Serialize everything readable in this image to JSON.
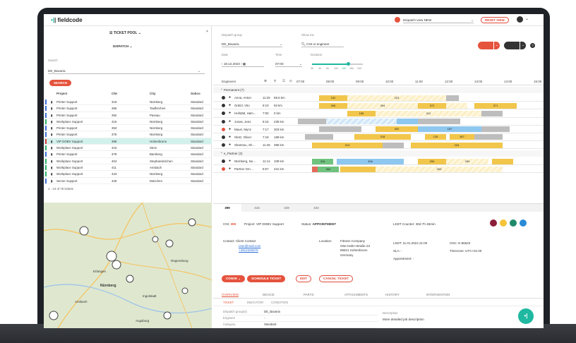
{
  "app": {
    "logo": "fieldcode",
    "dispatch_view": "Dispatch view NEW",
    "reset_view": "RESET VIEW"
  },
  "left": {
    "ticket_pool": "TICKET POOL",
    "dispatch": "DISPATCH",
    "search_label": "Search",
    "search_value": "DE_Bavaria",
    "search_button": "SEARCH",
    "columns": [
      "Project",
      "CNI",
      "City",
      "Subco"
    ],
    "rows": [
      {
        "project": "Printer Support",
        "cni": "319",
        "city": "Nürnberg",
        "subco": "Standard",
        "color": "#3b6fd6"
      },
      {
        "project": "Printer Support",
        "cni": "365",
        "city": "Taufkirchen",
        "subco": "Standard",
        "color": "#3b6fd6"
      },
      {
        "project": "Printer Support",
        "cni": "392",
        "city": "Passau",
        "subco": "Standard",
        "color": "#3b6fd6"
      },
      {
        "project": "Workplace Support",
        "cni": "415",
        "city": "Nürnberg",
        "subco": "Standard",
        "color": "#2fb36b"
      },
      {
        "project": "Printer Support",
        "cni": "353",
        "city": "Nürnberg",
        "subco": "Standard",
        "color": "#3b6fd6"
      },
      {
        "project": "Printer Support",
        "cni": "375",
        "city": "Nürnberg",
        "subco": "Standard",
        "color": "#3b6fd6"
      },
      {
        "project": "VIP DOBV Support",
        "cni": "399",
        "city": "Hohenbrunn",
        "subco": "Standard",
        "color": "#d63b3b"
      },
      {
        "project": "Workplace Support",
        "cni": "416",
        "city": "Stein",
        "subco": "Standard",
        "color": "#2fb36b"
      },
      {
        "project": "Printer Support",
        "cni": "378",
        "city": "Bamberg",
        "subco": "Standard",
        "color": "#3b6fd6"
      },
      {
        "project": "Workplace Support",
        "cni": "404",
        "city": "Stephanskirchen",
        "subco": "Standard",
        "color": "#2fb36b"
      },
      {
        "project": "Workplace Support",
        "cni": "411",
        "city": "Ansbach",
        "subco": "Standard",
        "color": "#2fb36b"
      },
      {
        "project": "Workplace Support",
        "cni": "423",
        "city": "Nürnberg",
        "subco": "Standard",
        "color": "#2fb36b"
      },
      {
        "project": "Server Support",
        "cni": "429",
        "city": "München",
        "subco": "Standard",
        "color": "#3b6fd6"
      }
    ],
    "count": "1 - 13 of 76 tickets"
  },
  "map": {
    "cities": [
      "Erlangen",
      "Nürnberg",
      "Ansbach",
      "Augsburg",
      "Regensburg",
      "Ingolstadt"
    ]
  },
  "gantt": {
    "dispatch_group_label": "Dispatch group",
    "dispatch_group": "DE_Bavaria",
    "show_me_label": "Show me",
    "show_me": "CNI or engineer",
    "date_label": "Date",
    "date": "19.12.2023",
    "time_label": "Time",
    "time": "07:00",
    "duration_label": "Duration",
    "durations": [
      "3h",
      "4h",
      "6h",
      "10h",
      "12h",
      "16h",
      "24h"
    ],
    "engineers_label": "Engineers",
    "hours": [
      "07:00",
      "08:00",
      "09:00",
      "10:00",
      "11:00",
      "12:00",
      "13:00",
      "14:00",
      "15:00"
    ],
    "group1": "Permanent (7)",
    "group2": "e_Partner (2)",
    "engineers": [
      {
        "name": "Anna, Anton",
        "time": "11:26",
        "dist": "58.6 km"
      },
      {
        "name": "Grätzl, Vito",
        "time": "9:10",
        "dist": "93 km"
      },
      {
        "name": "Hofstätt, Ham…",
        "time": "7:00",
        "dist": "0 km"
      },
      {
        "name": "Jonas, Jens",
        "time": "8:15",
        "dist": "235 km"
      },
      {
        "name": "Mauri, Mynz",
        "time": "7:17",
        "dist": "303 km"
      },
      {
        "name": "Oletz, Oliver",
        "time": "7:18",
        "dist": "189 km"
      },
      {
        "name": "Shamtou, Sh…",
        "time": "11:45",
        "dist": "396 km"
      },
      {
        "name": "Nürnberg, Nu…",
        "time": "11:14",
        "dist": "108 km"
      },
      {
        "name": "Partner Gm…",
        "time": "8:57",
        "dist": "431 km"
      }
    ]
  },
  "detail": {
    "tabs": [
      "399",
      "416",
      "429",
      "423"
    ],
    "cni_label": "CNI:",
    "cni": "399",
    "project_label": "Project:",
    "project": "VIP DOBV Support",
    "status_label": "Status:",
    "status": "APPOINTMENT",
    "lsdt_counter": "LSDT Counter: 30d 7h 45min",
    "contact_label": "Contact:",
    "contact_name": "Client Contact",
    "contact_email": "user@mail.com",
    "contact_phone": "+4912345678",
    "location_label": "Location:",
    "location": [
      "Fitness Company",
      "Otto-Hahn-Straße 23",
      "85521 Hohenbrunn",
      "Germany"
    ],
    "lsdt": "LSDT: 11.01.2024 21:00",
    "sla": "SLA: -",
    "appointment": "Appointment: -",
    "cnc": "CNC: E-86623",
    "timezone": "Timezone: UTC+01:00",
    "actions": [
      "CONVE",
      "SCHEDULE TICKET",
      "EDIT",
      "CANCEL TICKET"
    ],
    "main_tabs": [
      "OVERVIEW",
      "DEVICE",
      "PARTS",
      "ATTACHMENTS",
      "HISTORY",
      "INTERVENTION"
    ],
    "sub_tabs": [
      "TICKET",
      "INDICATOR",
      "CONDITION"
    ],
    "fields": [
      {
        "label": "Dispatch group(s)",
        "value": "DE_Bavaria"
      },
      {
        "label": "Engineer",
        "value": "-"
      },
      {
        "label": "Category",
        "value": "Standard"
      }
    ],
    "description_label": "Description",
    "description": "More detailed job description"
  }
}
